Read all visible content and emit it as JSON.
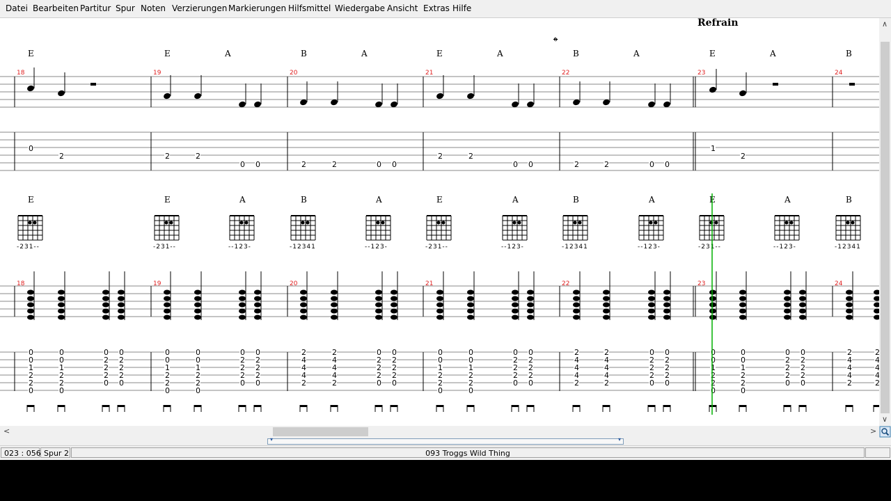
{
  "menu": [
    "Datei",
    "Bearbeiten",
    "Partitur",
    "Spur",
    "Noten",
    "Verzierungen",
    "Markierungen",
    "Hilfsmittel",
    "Wiedergabe",
    "Ansicht",
    "Extras",
    "Hilfe"
  ],
  "score": {
    "section_label": "Refrain",
    "coda_symbol": "𝄌",
    "measure_numbers": [
      "18",
      "19",
      "20",
      "21",
      "22",
      "23",
      "24"
    ],
    "chord_row1": [
      "E",
      "E",
      "A",
      "B",
      "A",
      "E",
      "A",
      "B",
      "A",
      "E",
      "A",
      "B"
    ],
    "chord_row2": [
      "E",
      "E",
      "A",
      "B",
      "A",
      "E",
      "A",
      "B",
      "A",
      "E",
      "A",
      "B"
    ],
    "chord_fingerings": [
      "-231--",
      "-231--",
      "--123-",
      "-12341",
      "--123-",
      "-231--",
      "--123-",
      "-12341",
      "--123-",
      "-231--",
      "--123-",
      "-12341"
    ],
    "tab1_numbers": [
      "0",
      "2",
      "2",
      "2",
      "0",
      "0",
      "2",
      "2",
      "0",
      "0",
      "2",
      "2",
      "0",
      "0",
      "2",
      "2",
      "0",
      "0",
      "1",
      "2"
    ],
    "tab2_column_E": [
      "0",
      "0",
      "1",
      "2",
      "2",
      "0"
    ],
    "tab2_column_A": [
      "0",
      "2",
      "2",
      "2",
      "0"
    ],
    "tab2_column_B": [
      "2",
      "4",
      "4",
      "4",
      "2"
    ]
  },
  "status": {
    "position": "023 : 056",
    "track": "Spur 2",
    "song": "093  Troggs  Wild Thing"
  },
  "colors": {
    "measure_number": "#e02020",
    "cursor": "#00b000"
  }
}
